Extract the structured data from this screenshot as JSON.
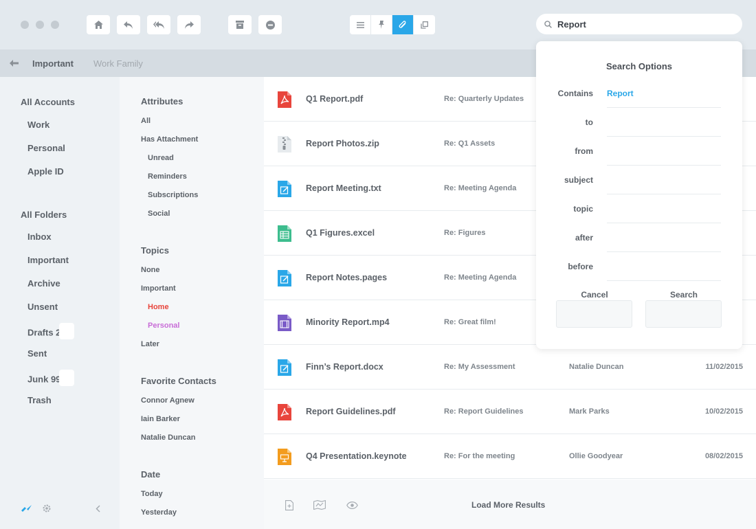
{
  "search": {
    "value": "Report"
  },
  "breadcrumb": {
    "current": "Important",
    "other": "Work Family"
  },
  "sidebar": {
    "accounts_heading": "All Accounts",
    "accounts": [
      "Work",
      "Personal",
      "Apple ID"
    ],
    "folders_heading": "All Folders",
    "folders": [
      {
        "label": "Inbox"
      },
      {
        "label": "Important"
      },
      {
        "label": "Archive"
      },
      {
        "label": "Unsent"
      },
      {
        "label": "Drafts 2"
      },
      {
        "label": "Sent"
      },
      {
        "label": "Junk 99"
      },
      {
        "label": "Trash"
      }
    ]
  },
  "filters": {
    "attributes_heading": "Attributes",
    "attributes": [
      "All",
      "Has Attachment"
    ],
    "attributes_sub": [
      "Unread",
      "Reminders",
      "Subscriptions",
      "Social"
    ],
    "topics_heading": "Topics",
    "topics": [
      "None",
      "Important"
    ],
    "topics_sub": [
      "Home",
      "Personal"
    ],
    "topics_later": "Later",
    "contacts_heading": "Favorite Contacts",
    "contacts": [
      "Connor Agnew",
      "Iain Barker",
      "Natalie Duncan"
    ],
    "date_heading": "Date",
    "dates": [
      "Today",
      "Yesterday"
    ],
    "colors": {
      "home": "#e8453c",
      "personal": "#c86dd7"
    }
  },
  "list": {
    "rows": [
      {
        "name": "Q1 Report.pdf",
        "subject": "Re: Quarterly Updates",
        "from": "",
        "date": "",
        "icon": "pdf-icon"
      },
      {
        "name": "Report Photos.zip",
        "subject": "Re: Q1 Assets",
        "from": "",
        "date": "",
        "icon": "zip-icon"
      },
      {
        "name": "Report Meeting.txt",
        "subject": "Re: Meeting Agenda",
        "from": "",
        "date": "",
        "icon": "text-doc-icon"
      },
      {
        "name": "Q1 Figures.excel",
        "subject": "Re: Figures",
        "from": "",
        "date": "",
        "icon": "spreadsheet-icon"
      },
      {
        "name": "Report Notes.pages",
        "subject": "Re: Meeting Agenda",
        "from": "",
        "date": "",
        "icon": "text-doc-icon"
      },
      {
        "name": "Minority Report.mp4",
        "subject": "Re: Great film!",
        "from": "",
        "date": "",
        "icon": "video-icon"
      },
      {
        "name": "Finn’s Report.docx",
        "subject": "Re: My Assessment",
        "from": "Natalie Duncan",
        "date": "11/02/2015",
        "icon": "text-doc-icon"
      },
      {
        "name": "Report Guidelines.pdf",
        "subject": "Re: Report Guidelines",
        "from": "Mark Parks",
        "date": "10/02/2015",
        "icon": "pdf-icon"
      },
      {
        "name": "Q4 Presentation.keynote",
        "subject": "Re: For the meeting",
        "from": "Ollie Goodyear",
        "date": "08/02/2015",
        "icon": "keynote-icon"
      }
    ],
    "load_more": "Load More Results"
  },
  "search_options": {
    "title": "Search Options",
    "fields": [
      {
        "label": "Contains",
        "value": "Report"
      },
      {
        "label": "to",
        "value": ""
      },
      {
        "label": "from",
        "value": ""
      },
      {
        "label": "subject",
        "value": ""
      },
      {
        "label": "topic",
        "value": ""
      },
      {
        "label": "after",
        "value": ""
      },
      {
        "label": "before",
        "value": ""
      }
    ],
    "cancel_label": "Cancel",
    "search_label": "Search"
  },
  "colors": {
    "accent": "#2aa7e8",
    "pdf": "#e8453c",
    "doc": "#2aa7e8",
    "sheet": "#3dbd8e",
    "video": "#7a5bc7",
    "keynote": "#f39c1e"
  }
}
